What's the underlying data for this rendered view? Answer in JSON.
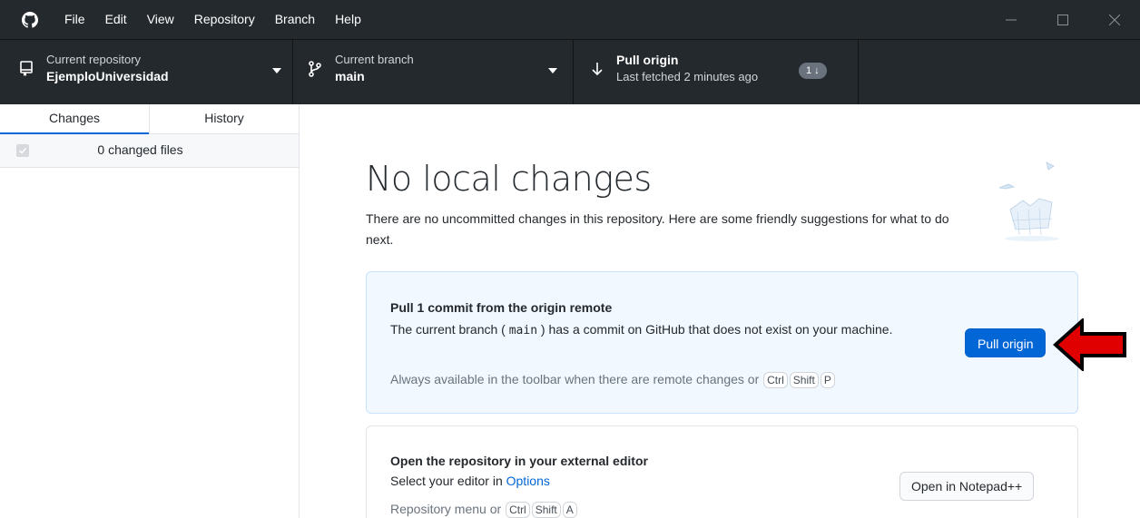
{
  "menu": [
    "File",
    "Edit",
    "View",
    "Repository",
    "Branch",
    "Help"
  ],
  "toolbar": {
    "repo_label": "Current repository",
    "repo_value": "EjemploUniversidad",
    "branch_label": "Current branch",
    "branch_value": "main",
    "pull_label": "Pull origin",
    "pull_sub": "Last fetched 2 minutes ago",
    "pull_badge": "1 ↓"
  },
  "sidebar": {
    "tabs": [
      "Changes",
      "History"
    ],
    "changes_count": "0 changed files"
  },
  "main": {
    "title": "No local changes",
    "subtitle": "There are no uncommitted changes in this repository. Here are some friendly suggestions for what to do next.",
    "pull_card": {
      "title": "Pull 1 commit from the origin remote",
      "desc_before": "The current branch ( ",
      "branch": "main",
      "desc_after": " ) has a commit on GitHub that does not exist on your machine.",
      "hint": "Always available in the toolbar when there are remote changes or",
      "keys": [
        "Ctrl",
        "Shift",
        "P"
      ],
      "button": "Pull origin"
    },
    "editor_card": {
      "title": "Open the repository in your external editor",
      "desc_before": "Select your editor in ",
      "desc_link": "Options",
      "hint": "Repository menu or",
      "keys": [
        "Ctrl",
        "Shift",
        "A"
      ],
      "button": "Open in Notepad++"
    }
  },
  "colors": {
    "titlebar": "#24292e",
    "accent": "#0366d6",
    "annotation_arrow": "#e00000"
  }
}
